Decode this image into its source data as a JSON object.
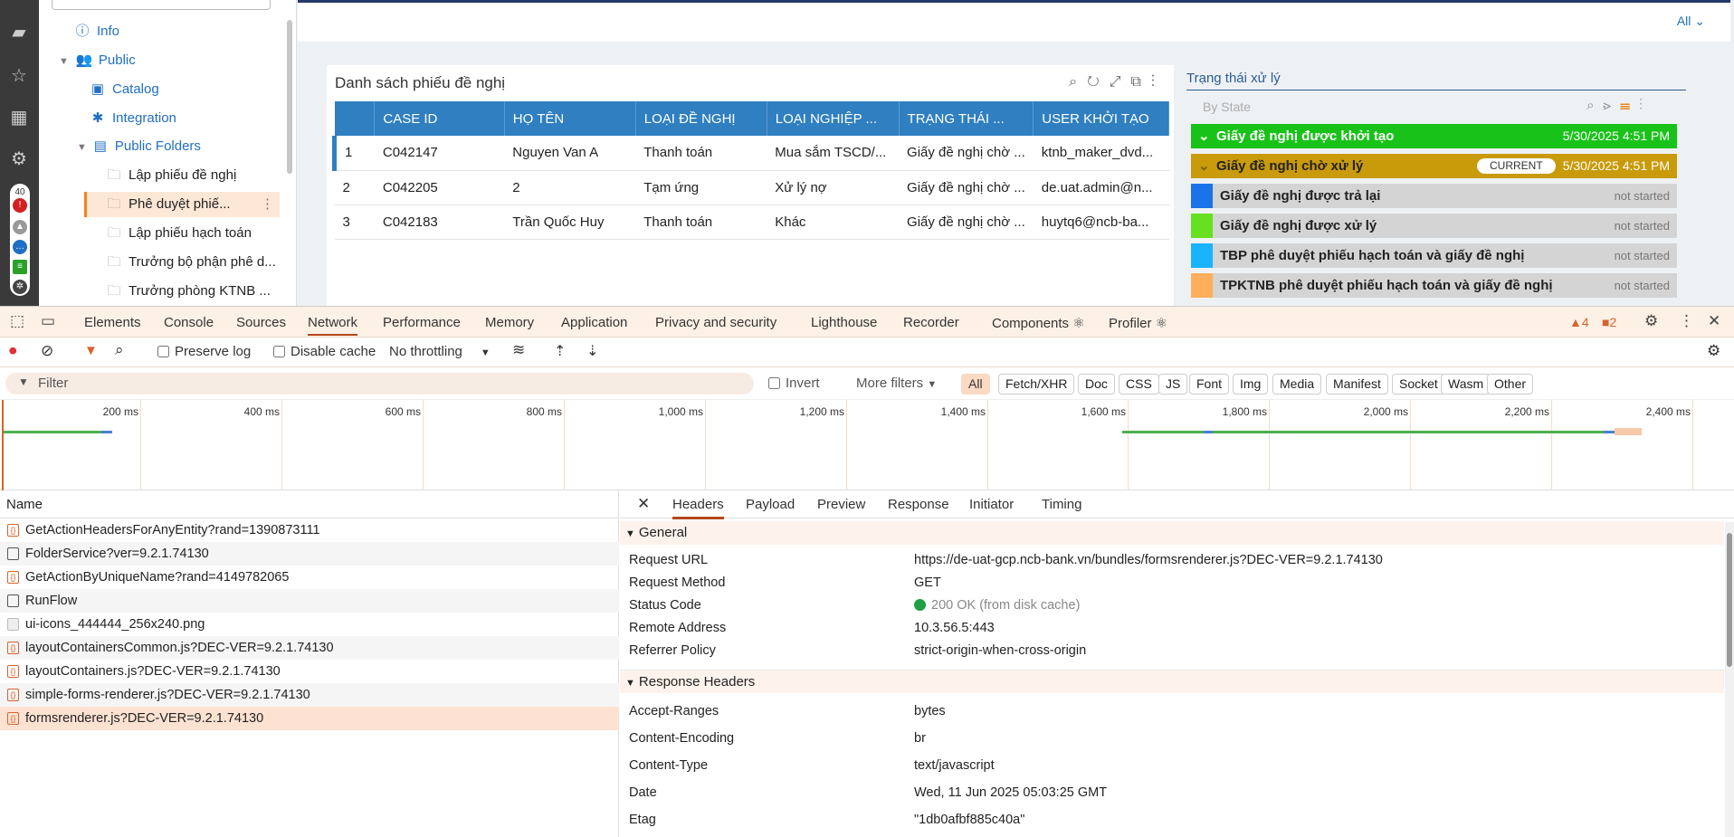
{
  "sidebar": {
    "items": [
      {
        "label": "Info",
        "icon": "info-icon"
      },
      {
        "label": "Public",
        "icon": "group-icon"
      },
      {
        "label": "Catalog",
        "icon": "catalog-icon"
      },
      {
        "label": "Integration",
        "icon": "integration-icon"
      },
      {
        "label": "Public Folders",
        "icon": "folders-icon"
      },
      {
        "label": "Lập phiếu đề nghị",
        "icon": "folder-icon"
      },
      {
        "label": "Phê duyệt phiế...",
        "icon": "folder-icon"
      },
      {
        "label": "Lập phiếu hạch toán",
        "icon": "folder-icon"
      },
      {
        "label": "Trưởng bộ phận phê d...",
        "icon": "folder-icon"
      },
      {
        "label": "Trưởng phòng KTNB ...",
        "icon": "folder-icon"
      }
    ],
    "badge_count": "40"
  },
  "topbar": {
    "filter_label": "All ⌄"
  },
  "grid": {
    "title": "Danh sách phiếu đề nghị",
    "columns": [
      "",
      "CASE ID",
      "HỌ TÊN",
      "LOẠI ĐỀ NGHỊ",
      "LOẠI NGHIỆP ...",
      "TRẠNG THÁI ...",
      "USER KHỞI TẠO"
    ],
    "rows": [
      [
        "1",
        "C042147",
        "Nguyen Van A",
        "Thanh toán",
        "Mua sắm TSCD/...",
        "Giấy đề nghị chờ ...",
        "ktnb_maker_dvd..."
      ],
      [
        "2",
        "C042205",
        "2",
        "Tạm ứng",
        "Xử lý nợ",
        "Giấy đề nghị chờ ...",
        "de.uat.admin@n..."
      ],
      [
        "3",
        "C042183",
        "Trần Quốc Huy",
        "Thanh toán",
        "Khác",
        "Giấy đề nghị chờ ...",
        "huytq6@ncb-ba..."
      ]
    ]
  },
  "status": {
    "title": "Trạng thái xử lý",
    "by_state": "By State",
    "rows": [
      {
        "label": "Giấy đề nghị được khởi tạo",
        "date": "5/30/2025 4:51 PM",
        "color": "#19c219"
      },
      {
        "label": "Giấy đề nghị chờ xử lý",
        "date": "5/30/2025 4:51 PM",
        "badge": "CURRENT",
        "color": "#c99a0a"
      },
      {
        "label": "Giấy đề nghị được trả lại",
        "state": "not started",
        "color": "#1a73e8"
      },
      {
        "label": "Giấy đề nghị được xử lý",
        "state": "not started",
        "color": "#66e01f"
      },
      {
        "label": "TBP phê duyệt phiếu hạch toán và giấy đề nghị",
        "state": "not started",
        "color": "#1ab3ff"
      },
      {
        "label": "TPKTNB phê duyệt phiếu hạch toán và giấy đề nghị",
        "state": "not started",
        "color": "#ffae5c"
      }
    ]
  },
  "devtools": {
    "tabs": [
      "Elements",
      "Console",
      "Sources",
      "Network",
      "Performance",
      "Memory",
      "Application",
      "Privacy and security",
      "Lighthouse",
      "Recorder",
      "Components ⚛",
      "Profiler ⚛"
    ],
    "active_tab": "Network",
    "warnings": "4",
    "errors": "2",
    "toolbar": {
      "preserve_log": "Preserve log",
      "disable_cache": "Disable cache",
      "throttling": "No throttling"
    },
    "filter": {
      "placeholder": "Filter",
      "invert": "Invert",
      "more_filters": "More filters",
      "types": [
        "All",
        "Fetch/XHR",
        "Doc",
        "CSS",
        "JS",
        "Font",
        "Img",
        "Media",
        "Manifest",
        "Socket",
        "Wasm",
        "Other"
      ]
    },
    "timeline": {
      "ticks": [
        "200 ms",
        "400 ms",
        "600 ms",
        "800 ms",
        "1,000 ms",
        "1,200 ms",
        "1,400 ms",
        "1,600 ms",
        "1,800 ms",
        "2,000 ms",
        "2,200 ms",
        "2,400 ms"
      ]
    },
    "requests": {
      "header": "Name",
      "items": [
        {
          "name": "GetActionHeadersForAnyEntity?rand=1390873111",
          "type": "xhr"
        },
        {
          "name": "FolderService?ver=9.2.1.74130",
          "type": "doc"
        },
        {
          "name": "GetActionByUniqueName?rand=4149782065",
          "type": "xhr"
        },
        {
          "name": "RunFlow",
          "type": "doc"
        },
        {
          "name": "ui-icons_444444_256x240.png",
          "type": "img"
        },
        {
          "name": "layoutContainersCommon.js?DEC-VER=9.2.1.74130",
          "type": "js"
        },
        {
          "name": "layoutContainers.js?DEC-VER=9.2.1.74130",
          "type": "js"
        },
        {
          "name": "simple-forms-renderer.js?DEC-VER=9.2.1.74130",
          "type": "js"
        },
        {
          "name": "formsrenderer.js?DEC-VER=9.2.1.74130",
          "type": "js"
        }
      ]
    },
    "detail": {
      "tabs": [
        "Headers",
        "Payload",
        "Preview",
        "Response",
        "Initiator",
        "Timing"
      ],
      "active": "Headers",
      "general_title": "General",
      "general": [
        {
          "k": "Request URL",
          "v": "https://de-uat-gcp.ncb-bank.vn/bundles/formsrenderer.js?DEC-VER=9.2.1.74130"
        },
        {
          "k": "Request Method",
          "v": "GET"
        },
        {
          "k": "Status Code",
          "v": "200 OK (from disk cache)"
        },
        {
          "k": "Remote Address",
          "v": "10.3.56.5:443"
        },
        {
          "k": "Referrer Policy",
          "v": "strict-origin-when-cross-origin"
        }
      ],
      "response_title": "Response Headers",
      "response": [
        {
          "k": "Accept-Ranges",
          "v": "bytes"
        },
        {
          "k": "Content-Encoding",
          "v": "br"
        },
        {
          "k": "Content-Type",
          "v": "text/javascript"
        },
        {
          "k": "Date",
          "v": "Wed, 11 Jun 2025 05:03:25 GMT"
        },
        {
          "k": "Etag",
          "v": "\"1db0afbf885c40a\""
        }
      ]
    }
  }
}
